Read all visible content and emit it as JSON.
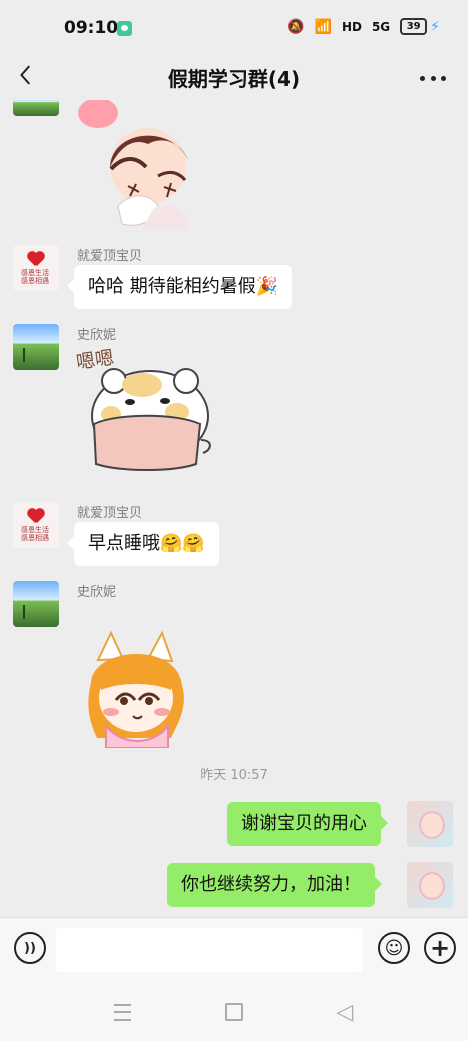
{
  "status_bar": {
    "time": "09:10",
    "network": "HD",
    "signal": "5G",
    "battery": "39"
  },
  "header": {
    "title": "假期学习群(4)",
    "back_icon": "chevron-left-icon",
    "more_icon": "more-icon"
  },
  "messages": [
    {
      "sender": "就爱顶宝贝",
      "text": "哈哈 期待能相约暑假🎉"
    },
    {
      "sender": "史欣妮",
      "sticker_text": "嗯嗯"
    },
    {
      "sender": "就爱顶宝贝",
      "text": "早点睡哦🤗🤗"
    },
    {
      "sender": "史欣妮",
      "sticker": "girl-sticker"
    },
    {
      "timestamp": "昨天 10:57"
    },
    {
      "sender": "self",
      "text": "谢谢宝贝的用心"
    },
    {
      "sender": "self",
      "text": "你也继续努力，加油！"
    }
  ],
  "input_bar": {
    "voice_icon": "voice-icon",
    "placeholder": "",
    "emoji_icon": "emoji-icon",
    "plus_icon": "plus-icon"
  },
  "nav_bar": {
    "menu_icon": "menu-icon",
    "home_icon": "home-icon",
    "back_icon": "back-triangle-icon"
  },
  "colors": {
    "background": "#ededed",
    "incoming_bubble": "#ffffff",
    "outgoing_bubble": "#95ec69",
    "accent": "#43c69a"
  }
}
